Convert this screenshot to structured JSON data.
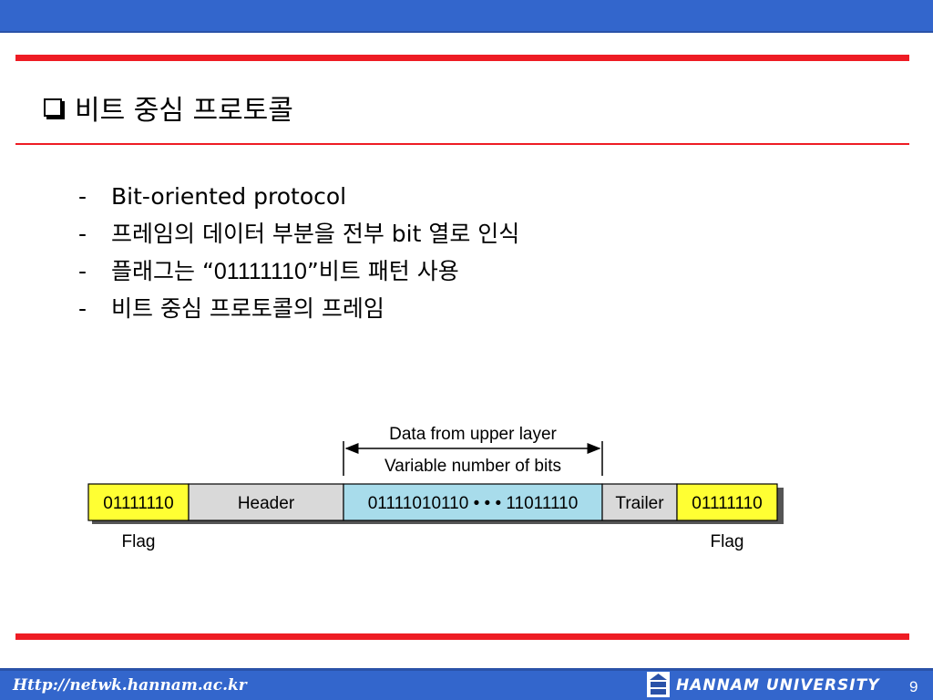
{
  "slide": {
    "title": "비트 중심 프로토콜",
    "bullets": [
      {
        "dash": "-",
        "text": "Bit-oriented protocol"
      },
      {
        "dash": "-",
        "text": "프레임의 데이터 부분을 전부 bit 열로 인식"
      },
      {
        "dash": "-",
        "pre": "플래그는 “",
        "num": "01111110",
        "post": "”비트 패턴 사용"
      },
      {
        "dash": "-",
        "text": "비트 중심 프로토콜의 프레임"
      }
    ]
  },
  "diagram": {
    "upper_label": "Data from upper layer",
    "variable_label": "Variable number of bits",
    "fields": {
      "flag_start": "01111110",
      "header": "Header",
      "data": "01111010110 • • • 11011110",
      "trailer": "Trailer",
      "flag_end": "01111110"
    },
    "flag_label_left": "Flag",
    "flag_label_right": "Flag",
    "colors": {
      "flag": "#ffff33",
      "header": "#d9d9d9",
      "data": "#a8dceb",
      "trailer": "#d9d9d9"
    }
  },
  "footer": {
    "url": "Http://netwk.hannam.ac.kr",
    "university": "HANNAM  UNIVERSITY",
    "page": "9",
    "logo_icon": "hannam-logo-icon"
  },
  "colors": {
    "band": "#3366cc",
    "rule": "#ee1c24"
  }
}
